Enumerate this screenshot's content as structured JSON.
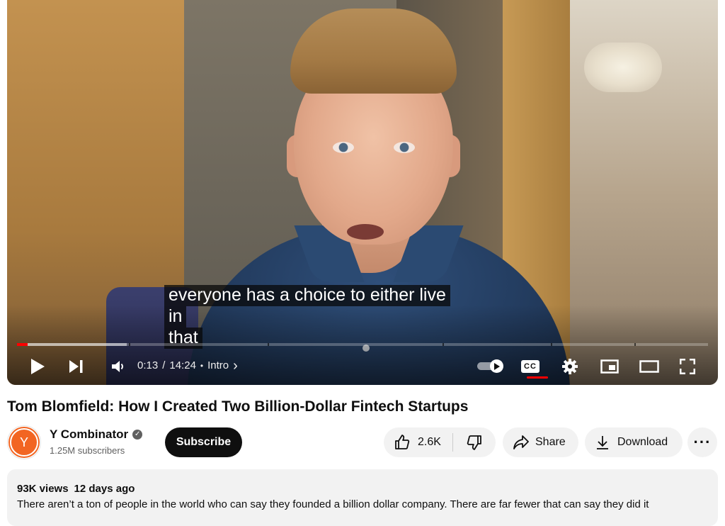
{
  "player": {
    "caption_line1": "everyone has a choice to either live in",
    "caption_line2": "that",
    "progress": {
      "played_fraction": 0.015,
      "buffered_fraction": 0.159
    },
    "time_current": "0:13",
    "time_separator": "/",
    "time_total": "14:24",
    "chapter_bullet": "•",
    "chapter": "Intro",
    "chapter_chevron": "›",
    "cc_label": "CC",
    "accent_color": "#ff0000",
    "icons": [
      "play-icon",
      "next-icon",
      "volume-icon",
      "autoplay-toggle-icon",
      "captions-icon",
      "settings-icon",
      "miniplayer-icon",
      "theater-mode-icon",
      "fullscreen-icon"
    ]
  },
  "video": {
    "title": "Tom Blomfield: How I Created Two Billion-Dollar Fintech Startups"
  },
  "channel": {
    "avatar_letter": "Y",
    "name": "Y Combinator",
    "verified_glyph": "✓",
    "subscribers": "1.25M subscribers",
    "subscribe_label": "Subscribe",
    "brand_color": "#f26522"
  },
  "actions": {
    "likes": "2.6K",
    "share_label": "Share",
    "download_label": "Download",
    "more_label": "···"
  },
  "description": {
    "views": "93K views",
    "date": "12 days ago",
    "text": "There aren’t a ton of people in the world who can say they founded a billion dollar company. There are far fewer that can say they did it"
  }
}
